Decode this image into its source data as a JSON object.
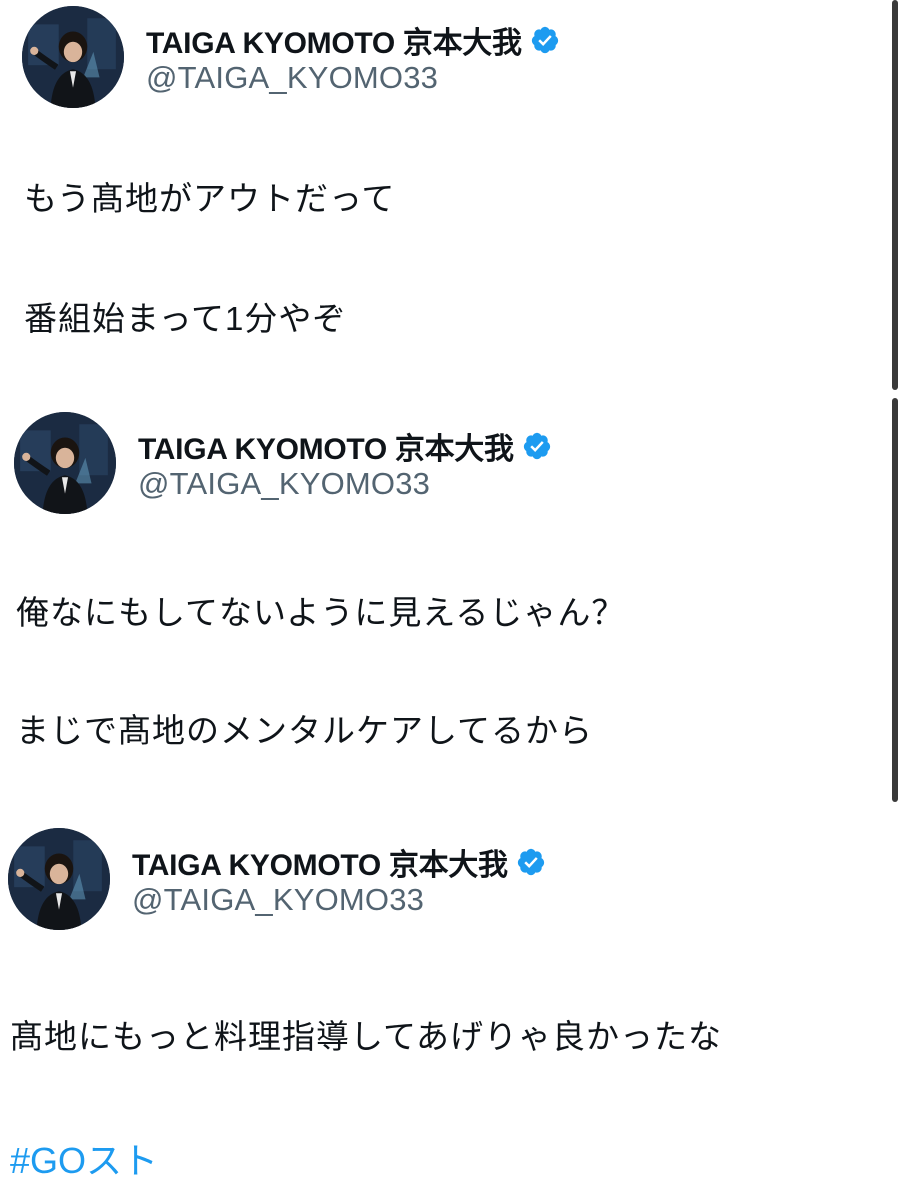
{
  "tweets": [
    {
      "display_name": "TAIGA KYOMOTO 京本大我",
      "handle": "@TAIGA_KYOMO33",
      "lines": [
        "もう髙地がアウトだって",
        "番組始まって1分やぞ"
      ]
    },
    {
      "display_name": "TAIGA KYOMOTO 京本大我",
      "handle": "@TAIGA_KYOMO33",
      "lines": [
        "俺なにもしてないように見えるじゃん？",
        "まじで髙地のメンタルケアしてるから"
      ]
    },
    {
      "display_name": "TAIGA KYOMOTO 京本大我",
      "handle": "@TAIGA_KYOMO33",
      "lines": [
        "髙地にもっと料理指導してあげりゃ良かったな"
      ],
      "hashtag": "#GOスト"
    }
  ],
  "icons": {
    "verified": "verified-badge-icon",
    "avatar": "profile-avatar"
  },
  "colors": {
    "text": "#0f1419",
    "secondary": "#536471",
    "link": "#1d9bf0",
    "verified": "#1d9bf0"
  }
}
